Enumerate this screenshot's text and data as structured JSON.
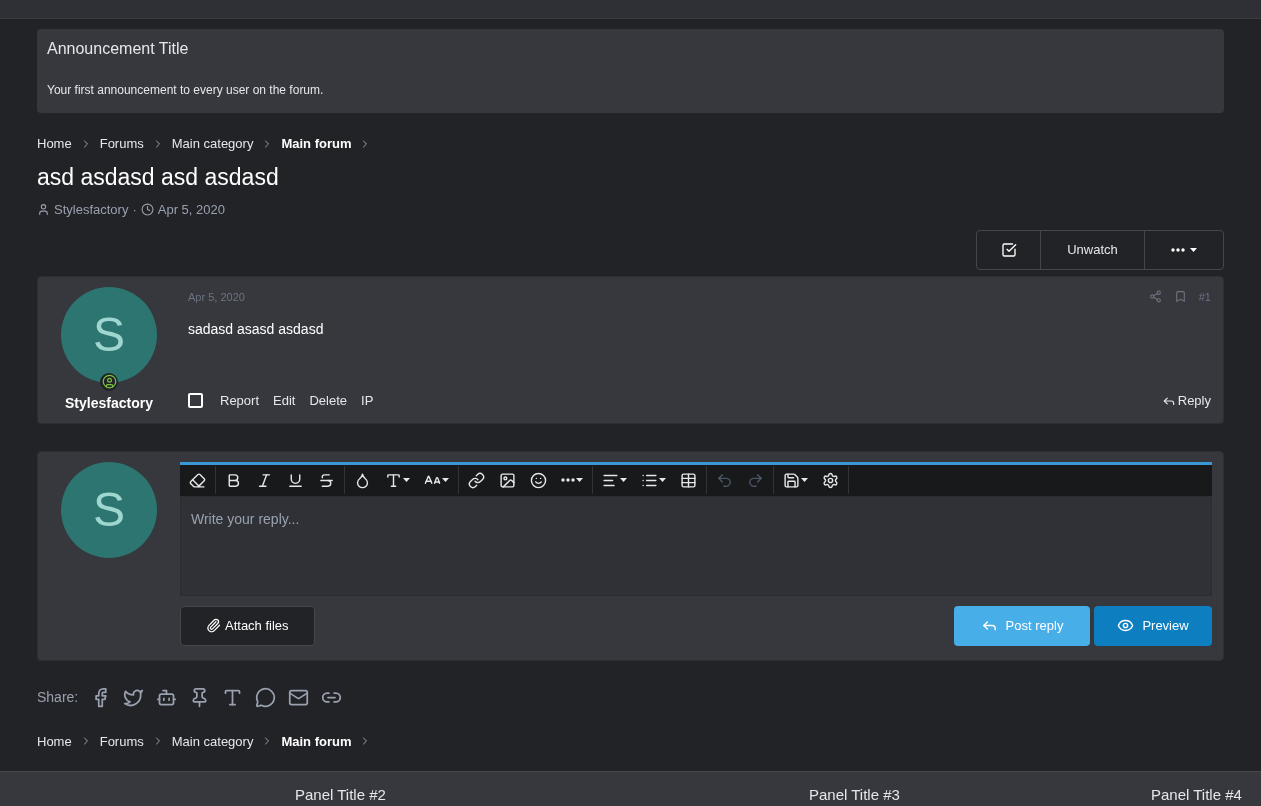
{
  "notice": {
    "title": "Announcement Title",
    "body": "Your first announcement to every user on the forum."
  },
  "breadcrumbs_top": [
    {
      "label": "Home",
      "current": false
    },
    {
      "label": "Forums",
      "current": false
    },
    {
      "label": "Main category",
      "current": false
    },
    {
      "label": "Main forum",
      "current": true
    }
  ],
  "thread": {
    "title": "asd asdasd asd asdasd",
    "author": "Stylesfactory",
    "separator": "·",
    "date": "Apr 5, 2020"
  },
  "thread_actions": {
    "watch_checked": true,
    "unwatch": "Unwatch"
  },
  "post": {
    "avatar_letter": "S",
    "author": "Stylesfactory",
    "online": true,
    "date": "Apr 5, 2020",
    "number": "#1",
    "body": "sadasd asasd asdasd",
    "selected": false,
    "actions": [
      "Report",
      "Edit",
      "Delete",
      "IP"
    ],
    "reply": "Reply"
  },
  "editor": {
    "avatar_letter": "S",
    "placeholder": "Write your reply...",
    "toolbar": [
      {
        "kind": "eraser",
        "disabled": false
      },
      {
        "kind": "bold",
        "disabled": false
      },
      {
        "kind": "italic",
        "disabled": false
      },
      {
        "kind": "underline",
        "disabled": false
      },
      {
        "kind": "strike",
        "disabled": false
      },
      {
        "kind": "color",
        "disabled": false
      },
      {
        "kind": "font",
        "disabled": false
      },
      {
        "kind": "size",
        "disabled": false
      },
      {
        "kind": "link",
        "disabled": false
      },
      {
        "kind": "image",
        "disabled": false
      },
      {
        "kind": "smile",
        "disabled": false
      },
      {
        "kind": "more",
        "disabled": false
      },
      {
        "kind": "align",
        "disabled": false
      },
      {
        "kind": "list",
        "disabled": false
      },
      {
        "kind": "table",
        "disabled": false
      },
      {
        "kind": "undo",
        "disabled": true
      },
      {
        "kind": "redo",
        "disabled": true
      },
      {
        "kind": "save",
        "disabled": false
      },
      {
        "kind": "settings",
        "disabled": false
      }
    ],
    "attach": "Attach files",
    "post_reply": "Post reply",
    "preview": "Preview"
  },
  "share": {
    "label": "Share:"
  },
  "breadcrumbs_bottom": [
    {
      "label": "Home",
      "current": false
    },
    {
      "label": "Forums",
      "current": false
    },
    {
      "label": "Main category",
      "current": false
    },
    {
      "label": "Main forum",
      "current": true
    }
  ],
  "footer_panels": [
    "Panel Title #2",
    "Panel Title #3",
    "Panel Title #4"
  ]
}
